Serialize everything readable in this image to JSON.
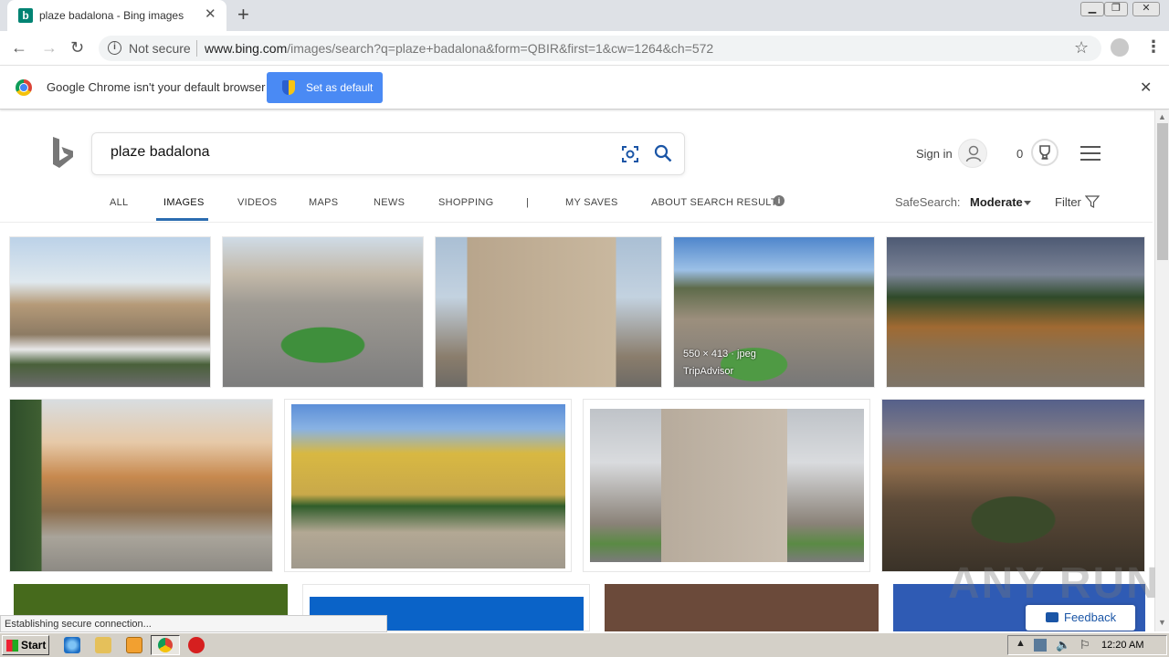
{
  "browser": {
    "tab_title": "plaze badalona - Bing images",
    "tab_favicon": "b",
    "not_secure": "Not secure",
    "url_host": "www.bing.com",
    "url_path": "/images/search?q=plaze+badalona&form=QBIR&first=1&cw=1264&ch=572"
  },
  "infobar": {
    "message": "Google Chrome isn't your default browser",
    "button_label": "Set as default"
  },
  "bing": {
    "query": "plaze badalona",
    "sign_in": "Sign in",
    "rewards_count": "0",
    "scopes": [
      {
        "label": "ALL"
      },
      {
        "label": "IMAGES"
      },
      {
        "label": "VIDEOS"
      },
      {
        "label": "MAPS"
      },
      {
        "label": "NEWS"
      },
      {
        "label": "SHOPPING"
      },
      {
        "label": "|"
      },
      {
        "label": "MY SAVES"
      },
      {
        "label": "ABOUT SEARCH RESULTS"
      }
    ],
    "safesearch_label": "SafeSearch:",
    "safesearch_value": "Moderate",
    "filter_label": "Filter"
  },
  "results": {
    "hover_overlay": {
      "dims": "550 × 413 · jpeg",
      "source": "TripAdvisor"
    }
  },
  "status_text": "Establishing secure connection...",
  "feedback_label": "Feedback",
  "watermark": "ANY RUN",
  "taskbar": {
    "start_label": "Start",
    "clock": "12:20 AM"
  },
  "colors": {
    "bing_teal": "#008373",
    "accent_blue": "#4a8af4",
    "link_blue": "#1a55a6"
  }
}
